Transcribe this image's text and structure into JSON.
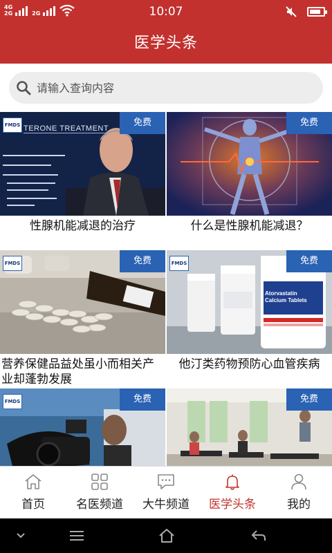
{
  "status_bar": {
    "network_top": "4G",
    "network_bottom": "2G",
    "time": "10:07"
  },
  "header": {
    "title": "医学头条"
  },
  "search": {
    "placeholder": "请输入查询内容"
  },
  "badge_label": "免费",
  "logo_text": "FMDS",
  "articles": [
    {
      "title": "性腺机能减退的治疗",
      "thumb_text": "TERONE TREATMENT"
    },
    {
      "title": "什么是性腺机能减退？"
    },
    {
      "title": "营养保健品益处虽小而相关产业却蓬勃发展"
    },
    {
      "title": "他汀类药物预防心血管疾病",
      "thumb_text": "Atorvastatin Calcium Tablets"
    },
    {
      "title": ""
    },
    {
      "title": ""
    }
  ],
  "bottom_nav": [
    {
      "label": "首页",
      "icon": "home-icon"
    },
    {
      "label": "名医频道",
      "icon": "grid-icon"
    },
    {
      "label": "大牛频道",
      "icon": "chat-icon"
    },
    {
      "label": "医学头条",
      "icon": "bell-icon",
      "active": true
    },
    {
      "label": "我的",
      "icon": "person-icon"
    }
  ],
  "colors": {
    "brand_red": "#c2312e",
    "badge_blue": "#2a62b4",
    "active_nav": "#c2312e"
  }
}
